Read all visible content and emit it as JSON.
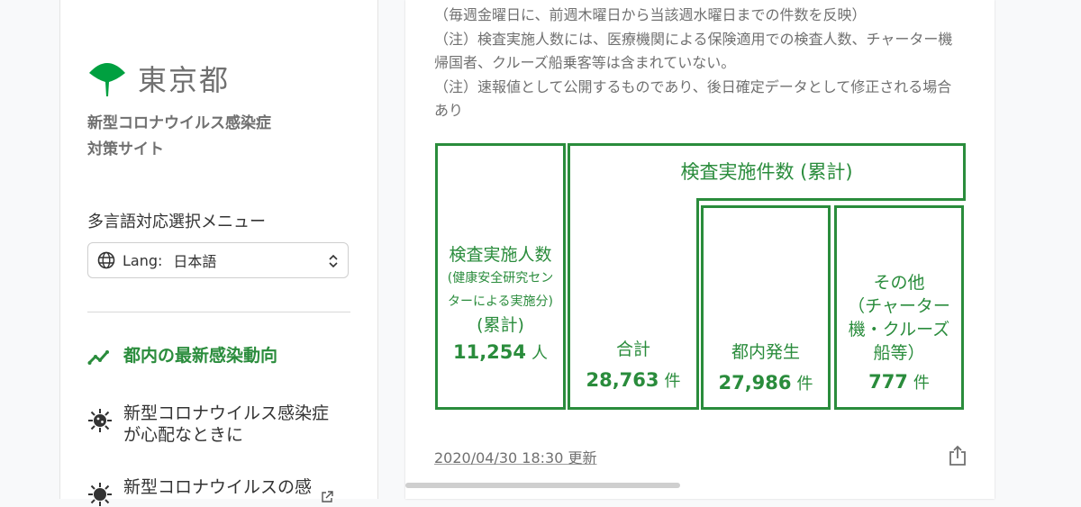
{
  "sidebar": {
    "logo_text": "東京都",
    "site_title_line1": "新型コロナウイルス感染症",
    "site_title_line2": "対策サイト",
    "lang_menu_label": "多言語対応選択メニュー",
    "lang_select": {
      "prefix": "Lang:",
      "value": "日本語"
    },
    "nav": [
      {
        "label": "都内の最新感染動向",
        "active": true
      },
      {
        "label": "新型コロナウイルス感染症が心配なときに",
        "line1": "新型コロナウイルス感染症",
        "line2": "が心配なときに"
      },
      {
        "label": "新型コロナウイルスの感",
        "external": true
      }
    ],
    "colors": {
      "brand_green": "#2a8c3c",
      "logo_green": "#00a040",
      "text_gray": "#707070"
    }
  },
  "main": {
    "notes": [
      "（毎週金曜日に、前週木曜日から当該週水曜日までの件数を反映）",
      "（注）検査実施人数には、医療機関による保険適用での検査人数、チャーター機帰国者、クルーズ船乗客等は含まれていない。",
      "（注）速報値として公開するものであり、後日確定データとして修正される場合あり"
    ],
    "test_people": {
      "label": "検査実施人数",
      "sub": "(健康安全研究センターによる実施分)",
      "cumulative": "(累計)",
      "value": "11,254",
      "unit": "人"
    },
    "tests_header": "検査実施件数 (累計)",
    "total": {
      "label": "合計",
      "value": "28,763",
      "unit": "件"
    },
    "in_tokyo": {
      "label": "都内発生",
      "value": "27,986",
      "unit": "件"
    },
    "others": {
      "label": "その他",
      "sub": "（チャーター機・クルーズ船等）",
      "value": "777",
      "unit": "件"
    },
    "updated": "2020/04/30 18:30 更新"
  }
}
